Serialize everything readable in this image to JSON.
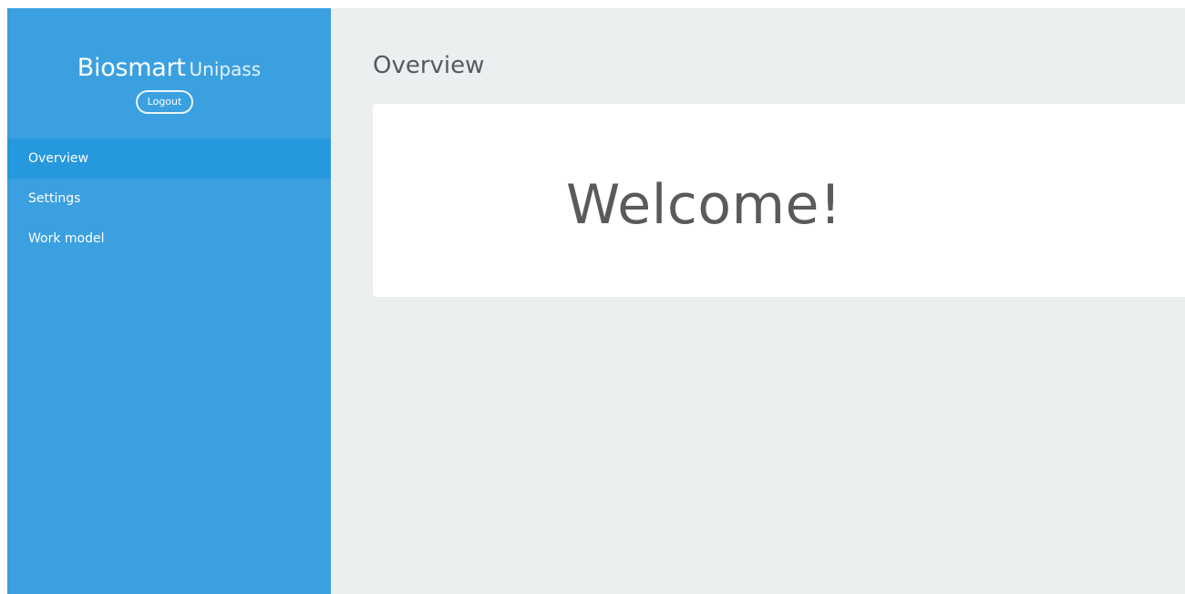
{
  "sidebar": {
    "brand_main": "Biosmart",
    "brand_sub": "Unipass",
    "logout_label": "Logout",
    "items": [
      {
        "label": "Overview",
        "active": true
      },
      {
        "label": "Settings",
        "active": false
      },
      {
        "label": "Work model",
        "active": false
      }
    ]
  },
  "main": {
    "title": "Overview",
    "welcome_text": "Welcome!"
  },
  "colors": {
    "sidebar_bg": "#3ba0e0",
    "sidebar_active": "#2698de",
    "content_bg": "#ebeff0",
    "card_bg": "#ffffff",
    "text_dark": "#5a5a5a"
  }
}
